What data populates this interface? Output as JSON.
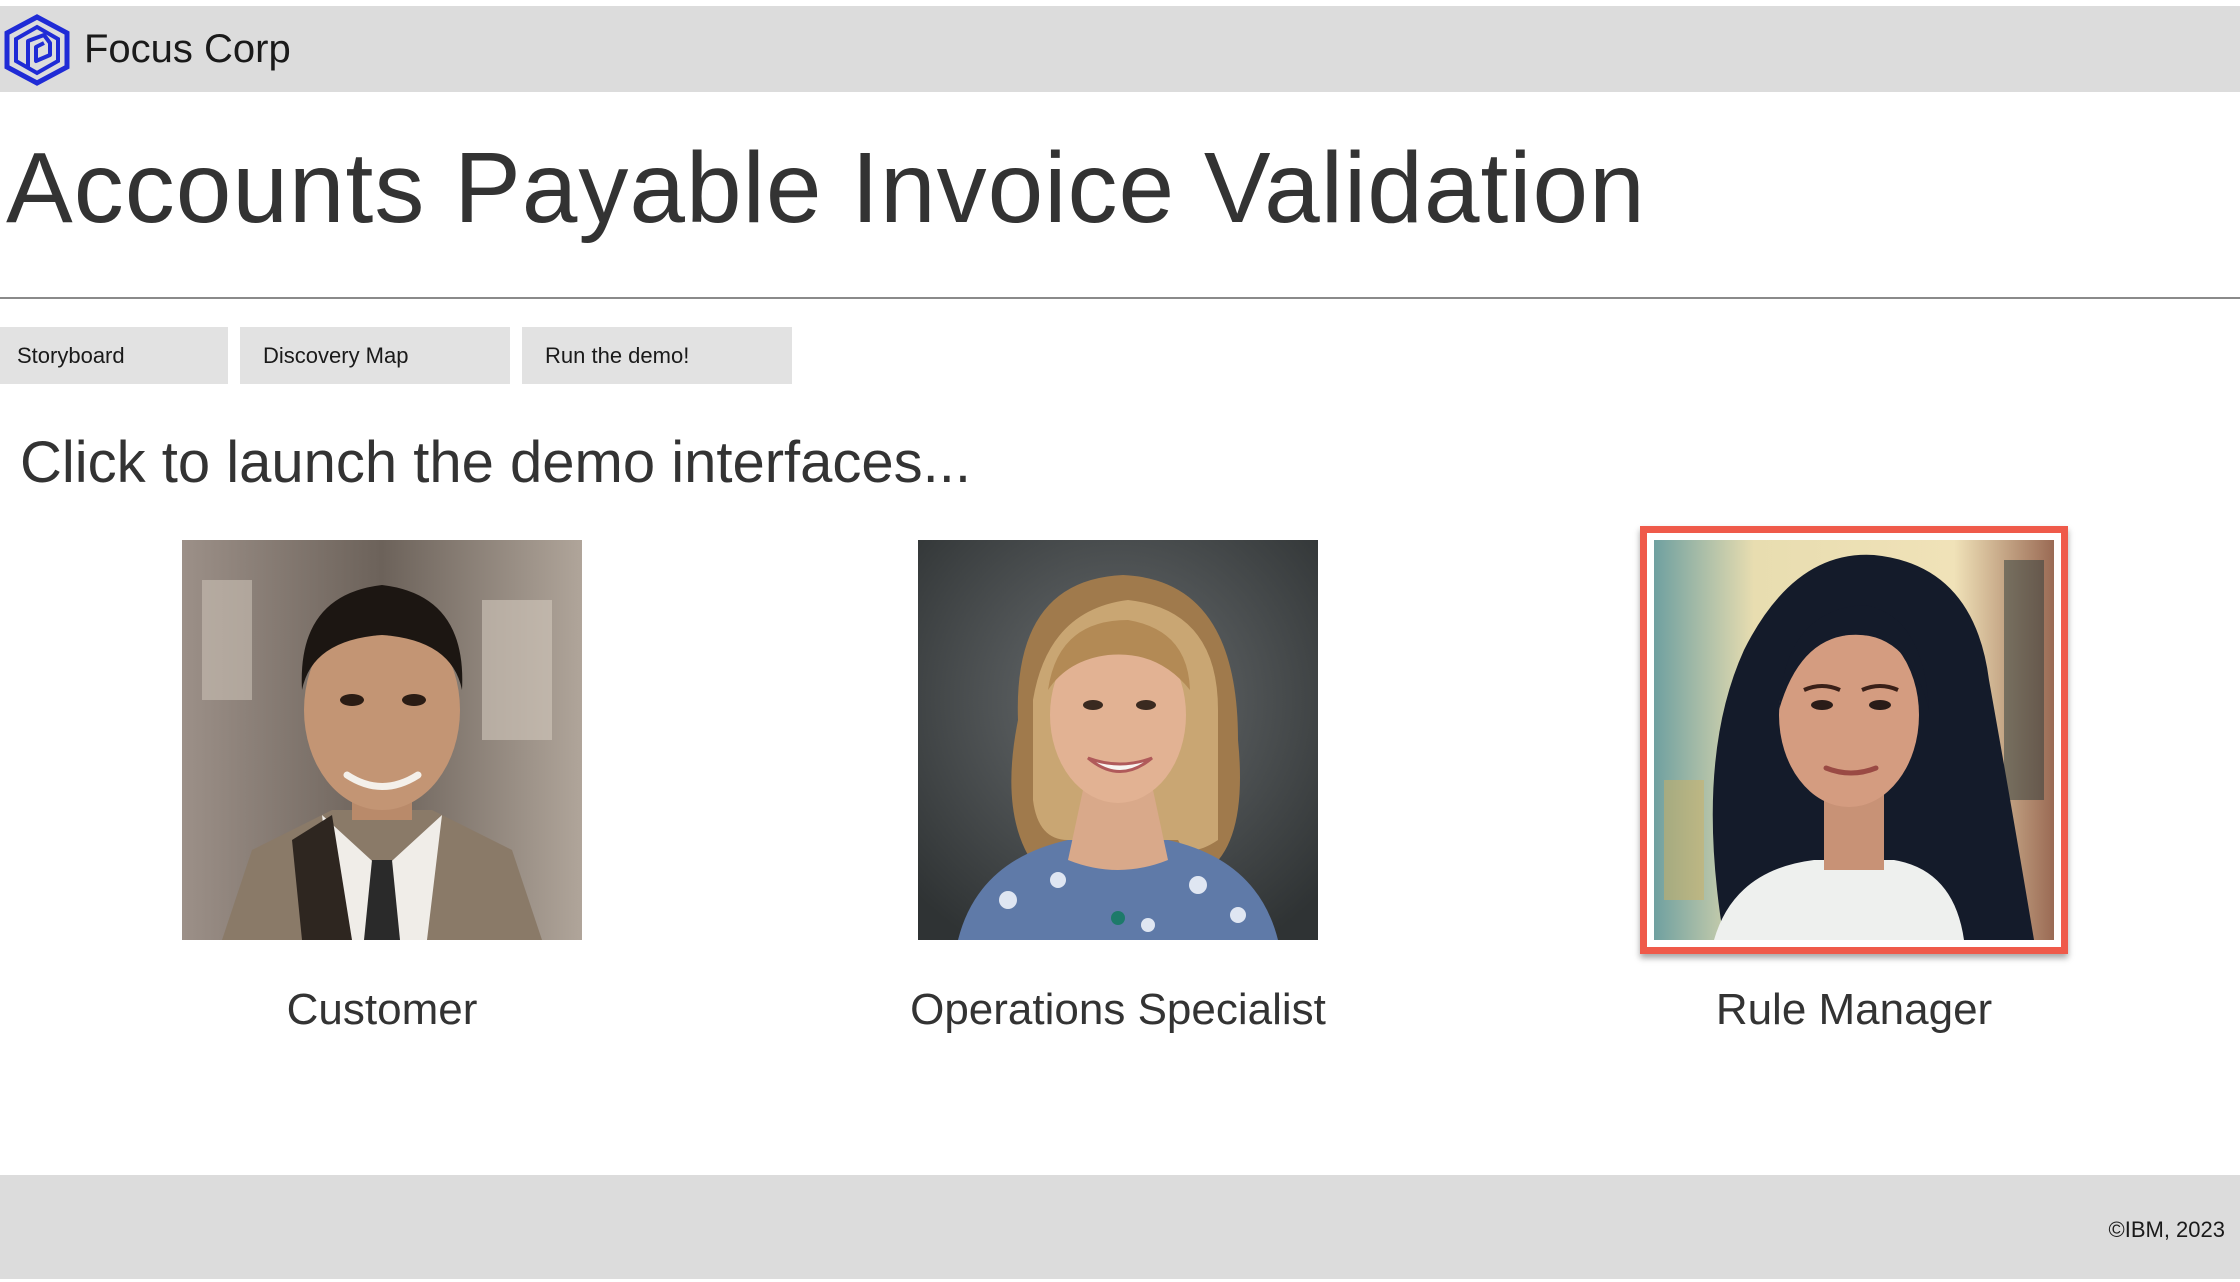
{
  "header": {
    "brand_name": "Focus Corp",
    "logo_icon": "hexagon-logo-icon",
    "logo_color": "#1f2bd6",
    "bar_color": "#dcdcdc"
  },
  "main": {
    "title": "Accounts Payable Invoice Validation",
    "nav_buttons": [
      {
        "label": "Storyboard"
      },
      {
        "label": "Discovery Map"
      },
      {
        "label": "Run the demo!"
      }
    ],
    "subtitle": "Click to launch the demo interfaces...",
    "personas": [
      {
        "label": "Customer",
        "image": "portrait-man-suit"
      },
      {
        "label": "Operations Specialist",
        "image": "portrait-woman-blond-hair"
      },
      {
        "label": "Rule Manager",
        "image": "portrait-woman-dark-hair",
        "selected": true,
        "highlight_color": "#ef5a4a"
      }
    ]
  },
  "footer": {
    "copyright": "©IBM, 2023"
  }
}
